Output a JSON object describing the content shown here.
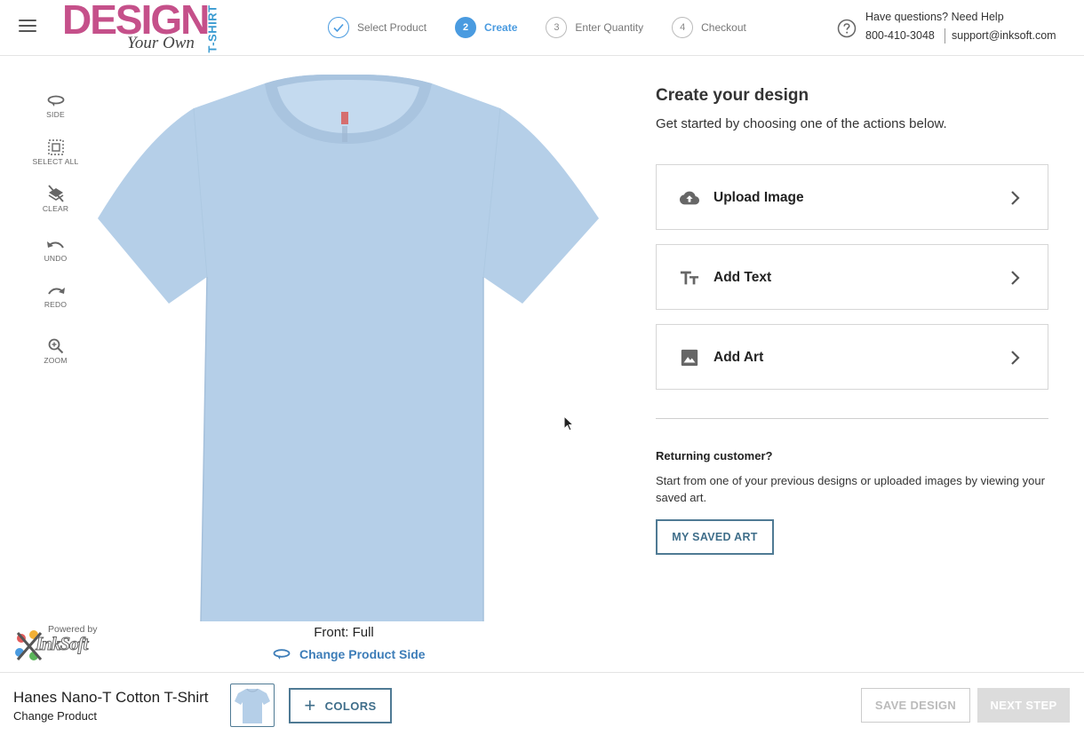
{
  "header": {
    "logo": {
      "main": "DESIGN",
      "sub": "Your Own",
      "vertical": "T-SHIRT"
    },
    "steps": [
      {
        "num": "1",
        "label": "Select Product",
        "state": "done"
      },
      {
        "num": "2",
        "label": "Create",
        "state": "active"
      },
      {
        "num": "3",
        "label": "Enter Quantity",
        "state": "pending"
      },
      {
        "num": "4",
        "label": "Checkout",
        "state": "pending"
      }
    ],
    "help": {
      "question": "Have questions? Need Help",
      "phone": "800-410-3048",
      "email": "support@inksoft.com"
    }
  },
  "tools": [
    {
      "icon": "rotate-side-icon",
      "label": "SIDE"
    },
    {
      "icon": "select-all-icon",
      "label": "SELECT ALL"
    },
    {
      "icon": "clear-layers-icon",
      "label": "CLEAR"
    },
    {
      "icon": "undo-icon",
      "label": "UNDO"
    },
    {
      "icon": "redo-icon",
      "label": "REDO"
    },
    {
      "icon": "zoom-icon",
      "label": "ZOOM"
    }
  ],
  "canvas": {
    "shirt_color": "#b5cfe8",
    "side_label": "Front: Full",
    "change_side": "Change Product Side"
  },
  "powered": {
    "prefix": "Powered by",
    "brand": "InkSoft"
  },
  "panel": {
    "title": "Create your design",
    "subtitle": "Get started by choosing one of the actions below.",
    "actions": [
      {
        "icon": "upload-cloud-icon",
        "label": "Upload Image"
      },
      {
        "icon": "text-icon",
        "label": "Add Text"
      },
      {
        "icon": "image-icon",
        "label": "Add Art"
      }
    ],
    "returning": {
      "title": "Returning customer?",
      "text": "Start from one of your previous designs or uploaded images by viewing your saved art.",
      "button": "MY SAVED ART"
    }
  },
  "footer": {
    "product_name": "Hanes Nano-T Cotton T-Shirt",
    "change_product": "Change Product",
    "colors_button": "COLORS",
    "save_button": "SAVE DESIGN",
    "next_button": "NEXT STEP"
  },
  "colors": {
    "accent": "#4a9be0",
    "button_border": "#4f7a94",
    "link": "#3d7db8"
  }
}
